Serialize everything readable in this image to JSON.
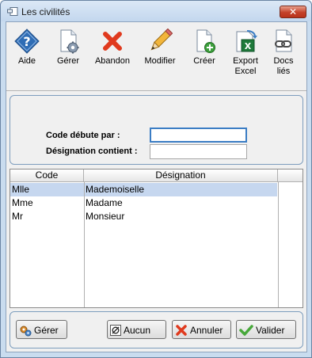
{
  "window": {
    "title": "Les civilités",
    "close_glyph": "✕"
  },
  "toolbar": {
    "items": [
      {
        "label": "Aide",
        "icon": "help-icon"
      },
      {
        "label": "Gérer",
        "icon": "document-gear-icon"
      },
      {
        "label": "Abandon",
        "icon": "red-x-icon"
      },
      {
        "label": "Modifier",
        "icon": "pencil-icon"
      },
      {
        "label": "Créer",
        "icon": "document-add-icon"
      },
      {
        "label": "Export\nExcel",
        "icon": "excel-export-icon"
      },
      {
        "label": "Docs\nliés",
        "icon": "linked-docs-icon"
      }
    ]
  },
  "filter": {
    "code_label": "Code débute par :",
    "code_value": "",
    "designation_label": "Désignation contient :",
    "designation_value": ""
  },
  "grid": {
    "columns": [
      "Code",
      "Désignation"
    ],
    "rows": [
      {
        "code": "Mlle",
        "designation": "Mademoiselle",
        "selected": true
      },
      {
        "code": "Mme",
        "designation": "Madame",
        "selected": false
      },
      {
        "code": "Mr",
        "designation": "Monsieur",
        "selected": false
      }
    ]
  },
  "buttons": {
    "gerer": "Gérer",
    "aucun": "Aucun",
    "annuler": "Annuler",
    "valider": "Valider"
  },
  "colors": {
    "selection": "#c6d7ef",
    "panel_border": "#7d9dbd",
    "focus_border": "#3b7dc4"
  }
}
